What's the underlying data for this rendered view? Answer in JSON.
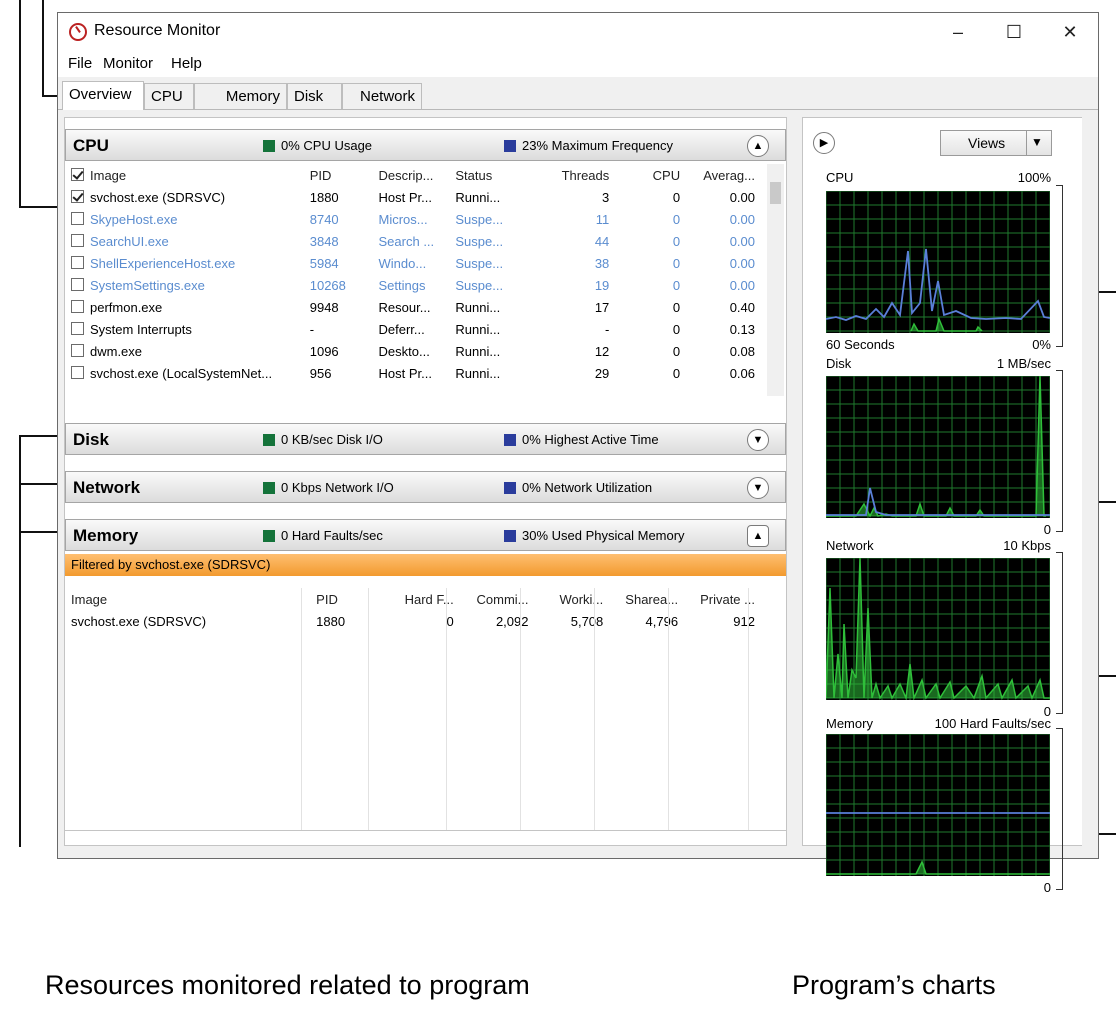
{
  "window": {
    "title": "Resource Monitor",
    "controls": {
      "minimize": "–",
      "maximize": "☐",
      "close": "✕"
    }
  },
  "menu": [
    "File",
    "Monitor",
    "Help"
  ],
  "tabs": [
    "Overview",
    "CPU",
    "Memory",
    "Disk",
    "Network"
  ],
  "active_tab": "Overview",
  "cpu_section": {
    "title": "CPU",
    "stat1": "0% CPU Usage",
    "stat2": "23% Maximum Frequency",
    "columns": [
      "Image",
      "PID",
      "Descrip...",
      "Status",
      "Threads",
      "CPU",
      "Averag..."
    ],
    "rows": [
      {
        "image": "svchost.exe (SDRSVC)",
        "pid": "1880",
        "desc": "Host Pr...",
        "status": "Runni...",
        "threads": "3",
        "cpu": "0",
        "avg": "0.00",
        "checked": true,
        "suspended": false
      },
      {
        "image": "SkypeHost.exe",
        "pid": "8740",
        "desc": "Micros...",
        "status": "Suspe...",
        "threads": "11",
        "cpu": "0",
        "avg": "0.00",
        "checked": false,
        "suspended": true
      },
      {
        "image": "SearchUI.exe",
        "pid": "3848",
        "desc": "Search ...",
        "status": "Suspe...",
        "threads": "44",
        "cpu": "0",
        "avg": "0.00",
        "checked": false,
        "suspended": true
      },
      {
        "image": "ShellExperienceHost.exe",
        "pid": "5984",
        "desc": "Windo...",
        "status": "Suspe...",
        "threads": "38",
        "cpu": "0",
        "avg": "0.00",
        "checked": false,
        "suspended": true
      },
      {
        "image": "SystemSettings.exe",
        "pid": "10268",
        "desc": "Settings",
        "status": "Suspe...",
        "threads": "19",
        "cpu": "0",
        "avg": "0.00",
        "checked": false,
        "suspended": true
      },
      {
        "image": "perfmon.exe",
        "pid": "9948",
        "desc": "Resour...",
        "status": "Runni...",
        "threads": "17",
        "cpu": "0",
        "avg": "0.40",
        "checked": false,
        "suspended": false
      },
      {
        "image": "System Interrupts",
        "pid": "-",
        "desc": "Deferr...",
        "status": "Runni...",
        "threads": "-",
        "cpu": "0",
        "avg": "0.13",
        "checked": false,
        "suspended": false
      },
      {
        "image": "dwm.exe",
        "pid": "1096",
        "desc": "Deskto...",
        "status": "Runni...",
        "threads": "12",
        "cpu": "0",
        "avg": "0.08",
        "checked": false,
        "suspended": false
      },
      {
        "image": "svchost.exe (LocalSystemNet...",
        "pid": "956",
        "desc": "Host Pr...",
        "status": "Runni...",
        "threads": "29",
        "cpu": "0",
        "avg": "0.06",
        "checked": false,
        "suspended": false
      }
    ]
  },
  "disk_section": {
    "title": "Disk",
    "stat1": "0 KB/sec Disk I/O",
    "stat2": "0% Highest Active Time"
  },
  "network_section": {
    "title": "Network",
    "stat1": "0 Kbps Network I/O",
    "stat2": "0% Network Utilization"
  },
  "memory_section": {
    "title": "Memory",
    "stat1": "0 Hard Faults/sec",
    "stat2": "30% Used Physical Memory",
    "filter": "Filtered by svchost.exe (SDRSVC)",
    "columns": [
      "Image",
      "PID",
      "Hard F...",
      "Commi...",
      "Worki...",
      "Sharea...",
      "Private ..."
    ],
    "rows": [
      {
        "image": "svchost.exe (SDRSVC)",
        "pid": "1880",
        "hard": "0",
        "commit": "2,092",
        "working": "5,708",
        "share": "4,796",
        "private": "912"
      }
    ]
  },
  "right_pane": {
    "views_label": "Views",
    "charts": [
      {
        "name": "CPU",
        "max": "100%",
        "bottom_left": "60 Seconds",
        "bottom_right": "0%"
      },
      {
        "name": "Disk",
        "max": "1 MB/sec",
        "bottom_left": "",
        "bottom_right": "0"
      },
      {
        "name": "Network",
        "max": "10 Kbps",
        "bottom_left": "",
        "bottom_right": "0"
      },
      {
        "name": "Memory",
        "max": "100 Hard Faults/sec",
        "bottom_left": "",
        "bottom_right": "0"
      }
    ]
  },
  "captions": {
    "left": "Resources monitored related to program",
    "right": "Program’s charts"
  },
  "colors": {
    "graph_grid": "#1f7a2e",
    "graph_green": "#2fbf3a",
    "graph_blue": "#5a7fd8",
    "filter_orange": "#f29a2e"
  }
}
